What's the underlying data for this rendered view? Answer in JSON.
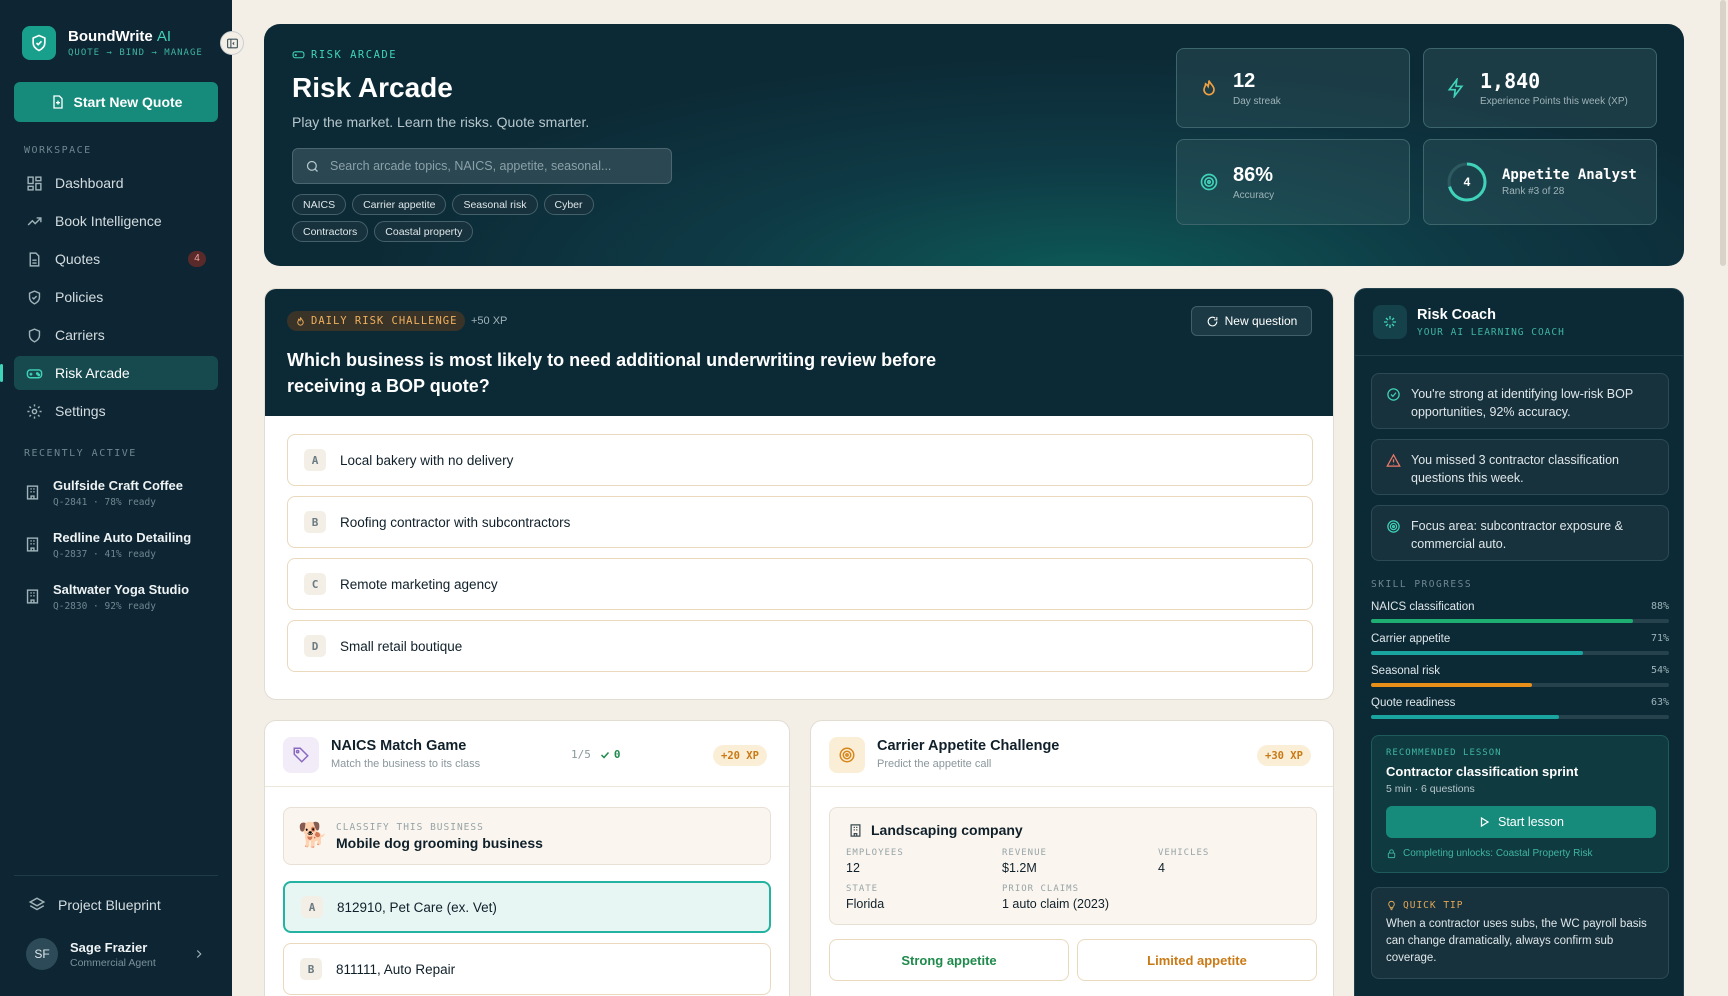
{
  "brand": {
    "name": "BoundWrite",
    "name_ai": "AI",
    "tagline": "QUOTE → BIND → MANAGE",
    "accent": "#19a08c"
  },
  "sidebar": {
    "start_button": "Start New Quote",
    "workspace_label": "WORKSPACE",
    "nav": [
      {
        "label": "Dashboard",
        "icon": "grid-icon"
      },
      {
        "label": "Book Intelligence",
        "icon": "trend-up-icon"
      },
      {
        "label": "Quotes",
        "icon": "document-icon",
        "badge": "4"
      },
      {
        "label": "Policies",
        "icon": "shield-check-icon"
      },
      {
        "label": "Carriers",
        "icon": "shield-icon"
      },
      {
        "label": "Risk Arcade",
        "icon": "gamepad-icon",
        "active": true
      },
      {
        "label": "Settings",
        "icon": "gear-icon"
      }
    ],
    "recent_label": "RECENTLY ACTIVE",
    "recent": [
      {
        "name": "Gulfside Craft Coffee",
        "meta": "Q-2841 · 78% ready"
      },
      {
        "name": "Redline Auto Detailing",
        "meta": "Q-2837 · 41% ready"
      },
      {
        "name": "Saltwater Yoga Studio",
        "meta": "Q-2830 · 92% ready"
      }
    ],
    "blueprint": "Project Blueprint",
    "user": {
      "initials": "SF",
      "name": "Sage Frazier",
      "role": "Commercial Agent"
    }
  },
  "hero": {
    "eyebrow": "RISK ARCADE",
    "title": "Risk Arcade",
    "subtitle": "Play the market. Learn the risks. Quote smarter.",
    "search_placeholder": "Search arcade topics, NAICS, appetite, seasonal...",
    "chips": [
      "NAICS",
      "Carrier appetite",
      "Seasonal risk",
      "Cyber",
      "Contractors",
      "Coastal property"
    ],
    "stats": {
      "streak": {
        "value": "12",
        "label": "Day streak"
      },
      "xp": {
        "value": "1,840",
        "label": "Experience Points this week (XP)"
      },
      "accuracy": {
        "value": "86%",
        "label": "Accuracy"
      },
      "rank": {
        "level": "4",
        "title": "Appetite Analyst",
        "label": "Rank #3 of 28"
      }
    }
  },
  "daily": {
    "pill": "DAILY RISK CHALLENGE",
    "xp": "+50 XP",
    "new_question": "New question",
    "question": "Which business is most likely to need additional underwriting review before receiving a BOP quote?",
    "options": [
      {
        "key": "A",
        "text": "Local bakery with no delivery"
      },
      {
        "key": "B",
        "text": "Roofing contractor with subcontractors"
      },
      {
        "key": "C",
        "text": "Remote marketing agency"
      },
      {
        "key": "D",
        "text": "Small retail boutique"
      }
    ]
  },
  "naics": {
    "title": "NAICS Match Game",
    "subtitle": "Match the business to its class",
    "progress": "1/5",
    "correct": "0",
    "xp": "+20 XP",
    "classify_label": "CLASSIFY THIS BUSINESS",
    "business": "Mobile dog grooming business",
    "business_emoji": "🐕",
    "answers": [
      {
        "key": "A",
        "text": "812910, Pet Care (ex. Vet)",
        "selected": true
      },
      {
        "key": "B",
        "text": "811111, Auto Repair"
      }
    ]
  },
  "carrier": {
    "title": "Carrier Appetite Challenge",
    "subtitle": "Predict the appetite call",
    "xp": "+30 XP",
    "business": "Landscaping company",
    "fields": {
      "employees": {
        "k": "EMPLOYEES",
        "v": "12"
      },
      "revenue": {
        "k": "REVENUE",
        "v": "$1.2M"
      },
      "vehicles": {
        "k": "VEHICLES",
        "v": "4"
      },
      "state": {
        "k": "STATE",
        "v": "Florida"
      },
      "claims": {
        "k": "PRIOR CLAIMS",
        "v": "1 auto claim (2023)"
      }
    },
    "buttons": [
      {
        "label": "Strong appetite",
        "color": "#1f8a4c"
      },
      {
        "label": "Limited appetite",
        "color": "#c97a16"
      }
    ]
  },
  "coach": {
    "title": "Risk Coach",
    "subtitle": "YOUR AI LEARNING COACH",
    "insights": [
      {
        "text": "You're strong at identifying low-risk BOP opportunities, 92% accuracy.",
        "icon": "check-circle-icon"
      },
      {
        "text": "You missed 3 contractor classification questions this week.",
        "icon": "warning-icon"
      },
      {
        "text": "Focus area: subcontractor exposure & commercial auto.",
        "icon": "target-icon"
      }
    ],
    "skill_label": "SKILL PROGRESS",
    "skills": [
      {
        "name": "NAICS classification",
        "pct": "88%",
        "value": 0.88,
        "color": "#1fae72"
      },
      {
        "name": "Carrier appetite",
        "pct": "71%",
        "value": 0.71,
        "color": "#1aa5a0"
      },
      {
        "name": "Seasonal risk",
        "pct": "54%",
        "value": 0.54,
        "color": "#e88f1a"
      },
      {
        "name": "Quote readiness",
        "pct": "63%",
        "value": 0.63,
        "color": "#1aa5a0"
      }
    ],
    "lesson": {
      "eyebrow": "RECOMMENDED LESSON",
      "title": "Contractor classification sprint",
      "meta": "5 min · 6 questions",
      "button": "Start lesson",
      "unlock": "Completing unlocks: Coastal Property Risk"
    },
    "tip": {
      "label": "QUICK TIP",
      "text": "When a contractor uses subs, the WC payroll basis can change dramatically, always confirm sub coverage."
    }
  }
}
